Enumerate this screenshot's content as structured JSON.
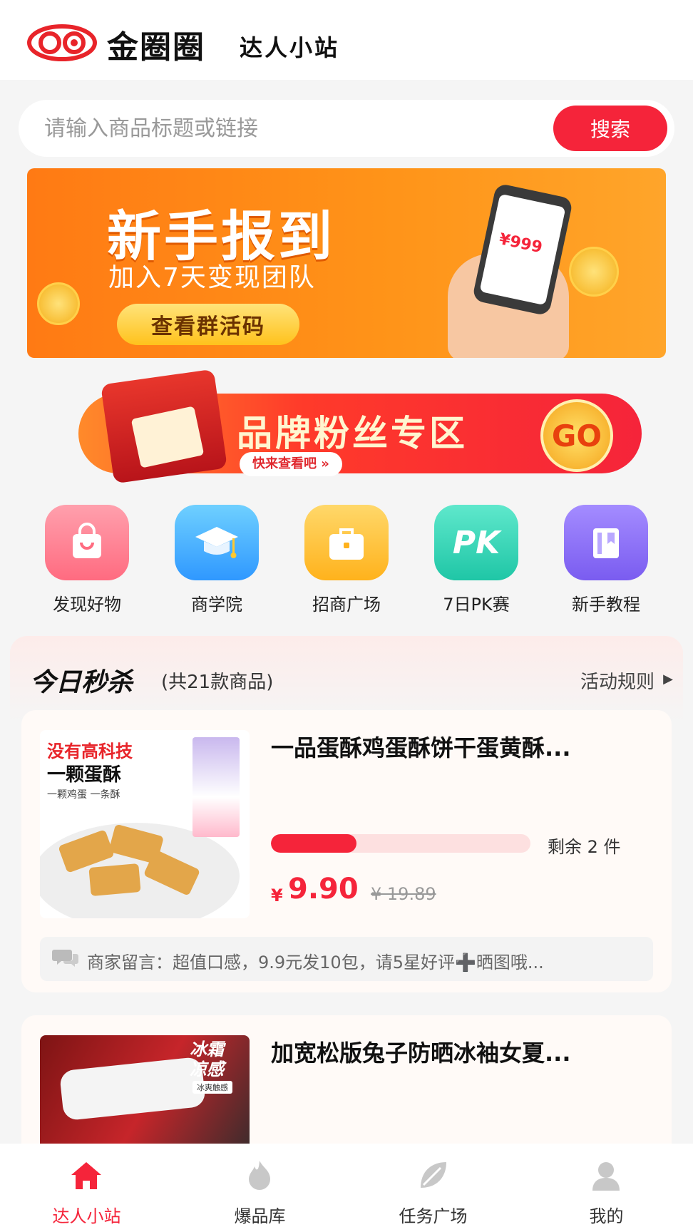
{
  "header": {
    "brand": "金圈圈",
    "title": "达人小站",
    "brand_color": "#e8242a"
  },
  "search": {
    "placeholder": "请输入商品标题或链接",
    "button": "搜索"
  },
  "banner_checkin": {
    "title": "新手报到",
    "subtitle": "加入7天变现团队",
    "button": "查看群活码",
    "phone_amount": "¥999"
  },
  "banner_brand": {
    "title": "品牌粉丝专区",
    "sub": "快来查看吧 »",
    "go": "GO"
  },
  "shortcuts": [
    {
      "label": "发现好物",
      "icon": "shopping-bag-icon",
      "color": "#ff7b8e"
    },
    {
      "label": "商学院",
      "icon": "graduation-cap-icon",
      "color": "#3fb2ff"
    },
    {
      "label": "招商广场",
      "icon": "briefcase-icon",
      "color": "#ffc02e"
    },
    {
      "label": "7日PK赛",
      "icon": "pk-icon",
      "color": "#2fd3b8",
      "icon_text": "PK"
    },
    {
      "label": "新手教程",
      "icon": "book-icon",
      "color": "#8a6bf2"
    }
  ],
  "flash_sale": {
    "title": "今日秒杀",
    "count": "(共21款商品)",
    "rules": "活动规则",
    "products": [
      {
        "title": "一品蛋酥鸡蛋酥饼干蛋黄酥...",
        "thumb_line1": "没有高科技",
        "thumb_line2": "一颗蛋酥",
        "thumb_line3": "一颗鸡蛋 一条酥",
        "progress": 0.33,
        "stock": "剩余 2 件",
        "currency": "¥",
        "price": "9.90",
        "original_price": "¥ 19.89",
        "note": "商家留言：超值口感，9.9元发10包，请5星好评➕晒图哦..."
      },
      {
        "title": "加宽松版兔子防晒冰袖女夏...",
        "thumb_text": "冰霜凉感",
        "thumb_tag": "冰爽触感"
      }
    ]
  },
  "tabbar": [
    {
      "label": "达人小站",
      "icon": "home-icon",
      "active": true
    },
    {
      "label": "爆品库",
      "icon": "fire-icon",
      "active": false
    },
    {
      "label": "任务广场",
      "icon": "leaf-icon",
      "active": false
    },
    {
      "label": "我的",
      "icon": "user-icon",
      "active": false
    }
  ],
  "colors": {
    "accent": "#f5243a",
    "orange": "#ff8a1c"
  }
}
